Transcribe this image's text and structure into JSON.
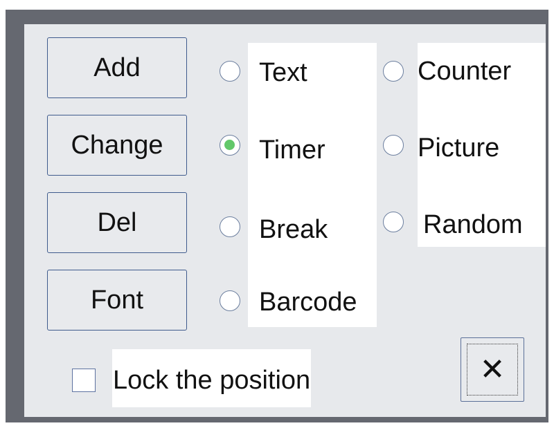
{
  "buttons": {
    "add": "Add",
    "change": "Change",
    "del": "Del",
    "font": "Font",
    "close": "✕"
  },
  "object_types": {
    "selected": "Timer",
    "options": [
      {
        "label": "Text",
        "checked": false
      },
      {
        "label": "Timer",
        "checked": true
      },
      {
        "label": "Break",
        "checked": false
      },
      {
        "label": "Barcode",
        "checked": false
      },
      {
        "label": "Counter",
        "checked": false
      },
      {
        "label": "Picture",
        "checked": false
      },
      {
        "label": "Random",
        "checked": false
      }
    ]
  },
  "lock": {
    "label": "Lock the position",
    "checked": false
  },
  "colors": {
    "frame": "#656870",
    "panel": "#e7e9ec",
    "border": "#3e5a8c",
    "radio_selected": "#62c86a"
  }
}
